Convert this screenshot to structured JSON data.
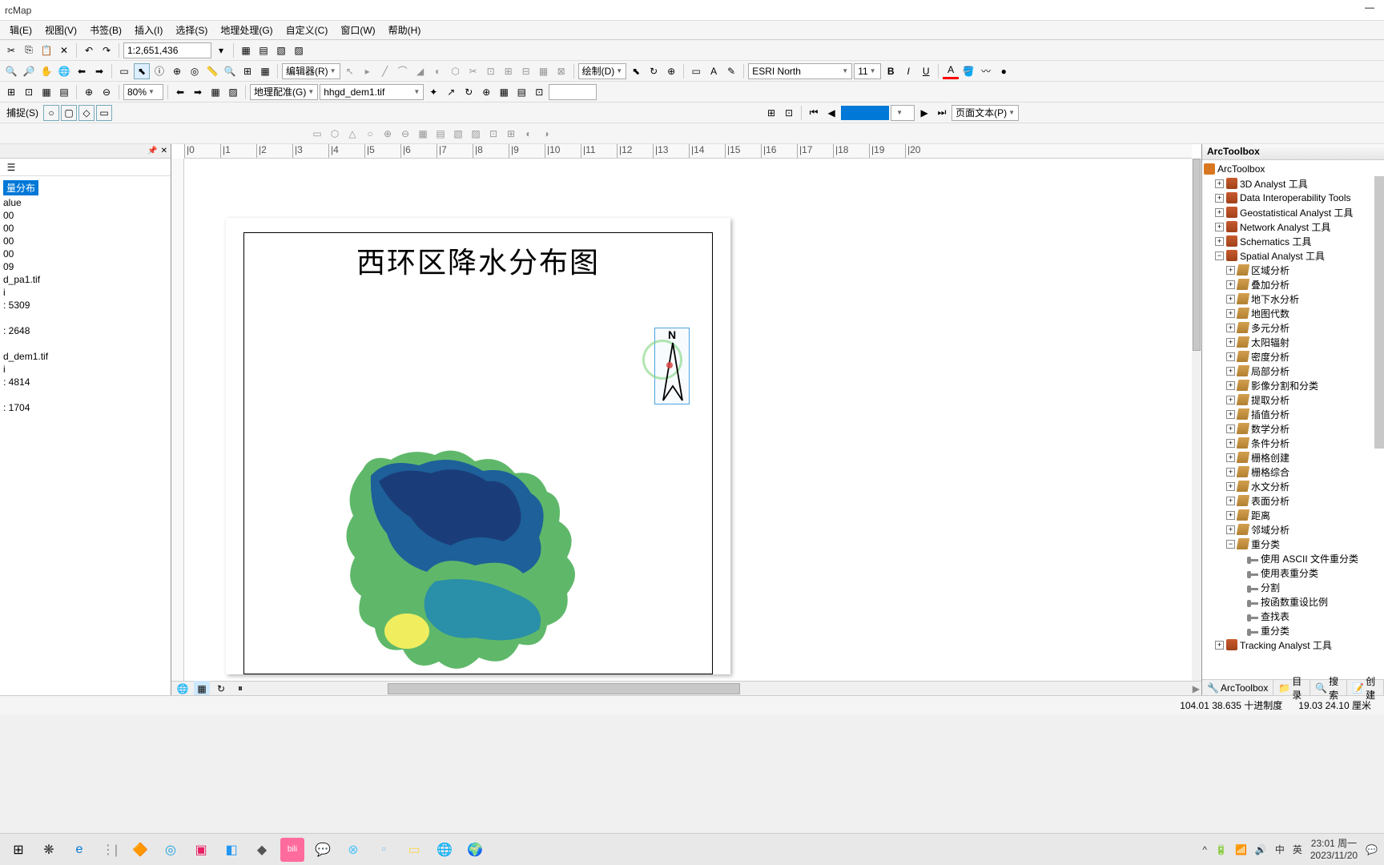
{
  "titlebar": {
    "app": "rcMap"
  },
  "menu": {
    "edit": "辑(E)",
    "view": "视图(V)",
    "bookmark": "书签(B)",
    "insert": "插入(I)",
    "select": "选择(S)",
    "geoprocessing": "地理处理(G)",
    "customize": "自定义(C)",
    "window": "窗口(W)",
    "help": "帮助(H)"
  },
  "toolbar1": {
    "scale": "1:2,651,436"
  },
  "toolbar2": {
    "editor": "编辑器(R)",
    "drawing": "绘制(D)",
    "font": "ESRI North",
    "fontsize": "11"
  },
  "toolbar3": {
    "zoom": "80%",
    "georef": "地理配准(G)",
    "layer": "hhgd_dem1.tif"
  },
  "toolbar4": {
    "snap": "捕捉(S)",
    "pagetext": "页面文本(P)"
  },
  "toc": {
    "sel": "量分布",
    "items": [
      "alue",
      "00",
      "00",
      "00",
      "00",
      "09",
      "d_pa1.tif",
      "i",
      ": 5309",
      "",
      ": 2648",
      "",
      "d_dem1.tif",
      "i",
      ": 4814",
      "",
      ": 1704"
    ]
  },
  "map": {
    "title": "西环区降水分布图",
    "north": "N"
  },
  "arctoolbox": {
    "title": "ArcToolbox",
    "root": "ArcToolbox",
    "toolboxes": [
      "3D Analyst 工具",
      "Data Interoperability Tools",
      "Geostatistical Analyst 工具",
      "Network Analyst 工具",
      "Schematics 工具",
      "Spatial Analyst 工具"
    ],
    "spatial_toolsets": [
      "区域分析",
      "叠加分析",
      "地下水分析",
      "地图代数",
      "多元分析",
      "太阳辐射",
      "密度分析",
      "局部分析",
      "影像分割和分类",
      "提取分析",
      "插值分析",
      "数学分析",
      "条件分析",
      "栅格创建",
      "栅格综合",
      "水文分析",
      "表面分析",
      "距离",
      "邻域分析",
      "重分类"
    ],
    "reclass_tools": [
      "使用 ASCII 文件重分类",
      "使用表重分类",
      "分割",
      "按函数重设比例",
      "查找表",
      "重分类"
    ],
    "last": "Tracking Analyst 工具",
    "tabs": {
      "toolbox": "ArcToolbox",
      "catalog": "目录",
      "search": "搜索",
      "create": "创建"
    }
  },
  "status": {
    "coords": "104.01  38.635 十进制度",
    "layout": "19.03  24.10 厘米"
  },
  "tray": {
    "ime1": "中",
    "ime2": "英",
    "time": "23:01 周一",
    "date": "2023/11/20"
  }
}
